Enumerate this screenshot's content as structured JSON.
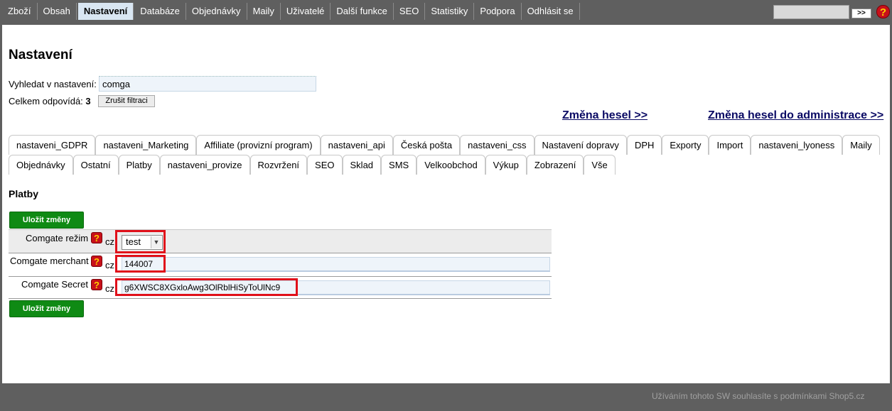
{
  "topmenu": [
    "Zboží",
    "Obsah",
    "Nastavení",
    "Databáze",
    "Objednávky",
    "Maily",
    "Uživatelé",
    "Další funkce",
    "SEO",
    "Statistiky",
    "Podpora",
    "Odhlásit se"
  ],
  "topbar": {
    "search_value": "",
    "go_label": ">>",
    "help_icon": "question-icon"
  },
  "page": {
    "title": "Nastavení",
    "search_label": "Vyhledat v nastavení:",
    "search_value": "comga",
    "count_label": "Celkem odpovídá:",
    "count_value": "3",
    "clear_filter_label": "Zrušit filtraci",
    "link_hesla": "Změna hesel >>",
    "link_hesla_admin": "Změna hesel do administrace >>"
  },
  "tabs_row1": [
    "nastaveni_GDPR",
    "nastaveni_Marketing",
    "Affiliate (provizní program)",
    "nastaveni_api",
    "Česká pošta",
    "nastaveni_css",
    "Nastavení dopravy",
    "DPH",
    "Exporty",
    "Import",
    "nastaveni_lyoness",
    "Maily"
  ],
  "tabs_row2": [
    "Objednávky",
    "Ostatní",
    "Platby",
    "nastaveni_provize",
    "Rozvržení",
    "SEO",
    "Sklad",
    "SMS",
    "Velkoobchod",
    "Výkup",
    "Zobrazení",
    "Vše"
  ],
  "section": {
    "title": "Platby",
    "save_label": "Uložit změny",
    "rows": {
      "rezim": {
        "label": "Comgate režim",
        "lang": "cz",
        "value": "test"
      },
      "merchant": {
        "label": "Comgate merchant",
        "lang": "cz",
        "value": "144007"
      },
      "secret": {
        "label": "Comgate Secret",
        "lang": "cz",
        "value": "g6XWSC8XGxloAwg3OlRblHiSyToUlNc9"
      }
    }
  },
  "footer": {
    "text": "Užíváním tohoto SW souhlasíte s podmínkami Shop5.cz"
  },
  "colors": {
    "accent_green": "#0f8a14",
    "highlight_red": "#e0101a",
    "chrome_gray": "#5f5f5f",
    "link_navy": "#0a0a64"
  }
}
